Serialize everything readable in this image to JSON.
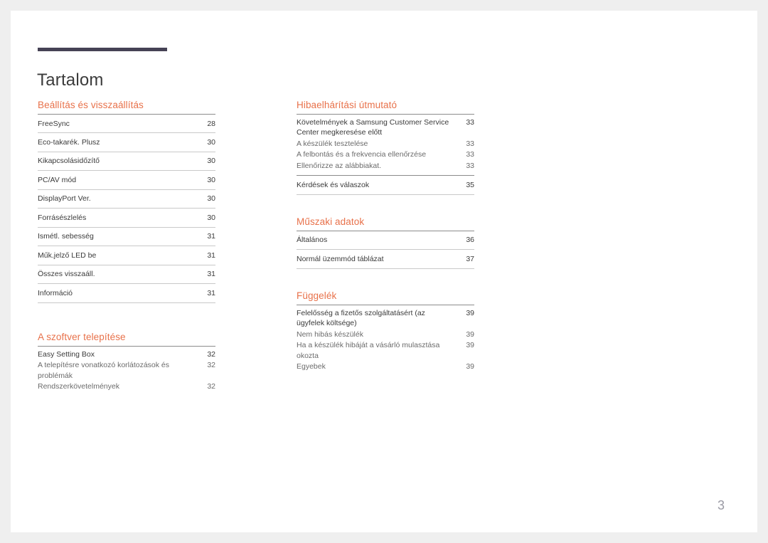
{
  "document": {
    "title": "Tartalom",
    "folio": "3",
    "accent_color": "#e8714a",
    "bar_color": "#464255"
  },
  "columns": {
    "left": [
      {
        "title": "Beállítás és visszaállítás",
        "entries": [
          {
            "label": "FreeSync",
            "page": "28",
            "level": "main"
          },
          {
            "label": "Eco-takarék. Plusz",
            "page": "30",
            "level": "main"
          },
          {
            "label": "Kikapcsolásidőzítő",
            "page": "30",
            "level": "main"
          },
          {
            "label": "PC/AV mód",
            "page": "30",
            "level": "main"
          },
          {
            "label": "DisplayPort Ver.",
            "page": "30",
            "level": "main"
          },
          {
            "label": "Forrásészlelés",
            "page": "30",
            "level": "main"
          },
          {
            "label": "Ismétl. sebesség",
            "page": "31",
            "level": "main"
          },
          {
            "label": "Műk.jelző LED be",
            "page": "31",
            "level": "main"
          },
          {
            "label": "Összes visszaáll.",
            "page": "31",
            "level": "main"
          },
          {
            "label": "Információ",
            "page": "31",
            "level": "main"
          }
        ]
      },
      {
        "title": "A szoftver telepítése",
        "entries": [
          {
            "label": "Easy Setting Box",
            "page": "32",
            "level": "main"
          },
          {
            "label": "A telepítésre vonatkozó korlátozások és problémák",
            "page": "32",
            "level": "sub"
          },
          {
            "label": "Rendszerkövetelmények",
            "page": "32",
            "level": "sub"
          }
        ]
      }
    ],
    "right": [
      {
        "title": "Hibaelhárítási útmutató",
        "entries": [
          {
            "label": "Követelmények a Samsung Customer Service Center megkeresése előtt",
            "page": "33",
            "level": "main"
          },
          {
            "label": "A készülék tesztelése",
            "page": "33",
            "level": "sub"
          },
          {
            "label": "A felbontás és a frekvencia ellenőrzése",
            "page": "33",
            "level": "sub"
          },
          {
            "label": "Ellenőrizze az alábbiakat.",
            "page": "33",
            "level": "sub"
          },
          {
            "label": "Kérdések és válaszok",
            "page": "35",
            "level": "main"
          }
        ]
      },
      {
        "title": "Műszaki adatok",
        "entries": [
          {
            "label": "Általános",
            "page": "36",
            "level": "main"
          },
          {
            "label": "Normál üzemmód táblázat",
            "page": "37",
            "level": "main"
          }
        ]
      },
      {
        "title": "Függelék",
        "entries": [
          {
            "label": "Felelősség a fizetős szolgáltatásért (az ügyfelek költsége)",
            "page": "39",
            "level": "main"
          },
          {
            "label": "Nem hibás készülék",
            "page": "39",
            "level": "sub"
          },
          {
            "label": "Ha a készülék hibáját a vásárló mulasztása okozta",
            "page": "39",
            "level": "sub"
          },
          {
            "label": "Egyebek",
            "page": "39",
            "level": "sub"
          }
        ]
      }
    ]
  }
}
